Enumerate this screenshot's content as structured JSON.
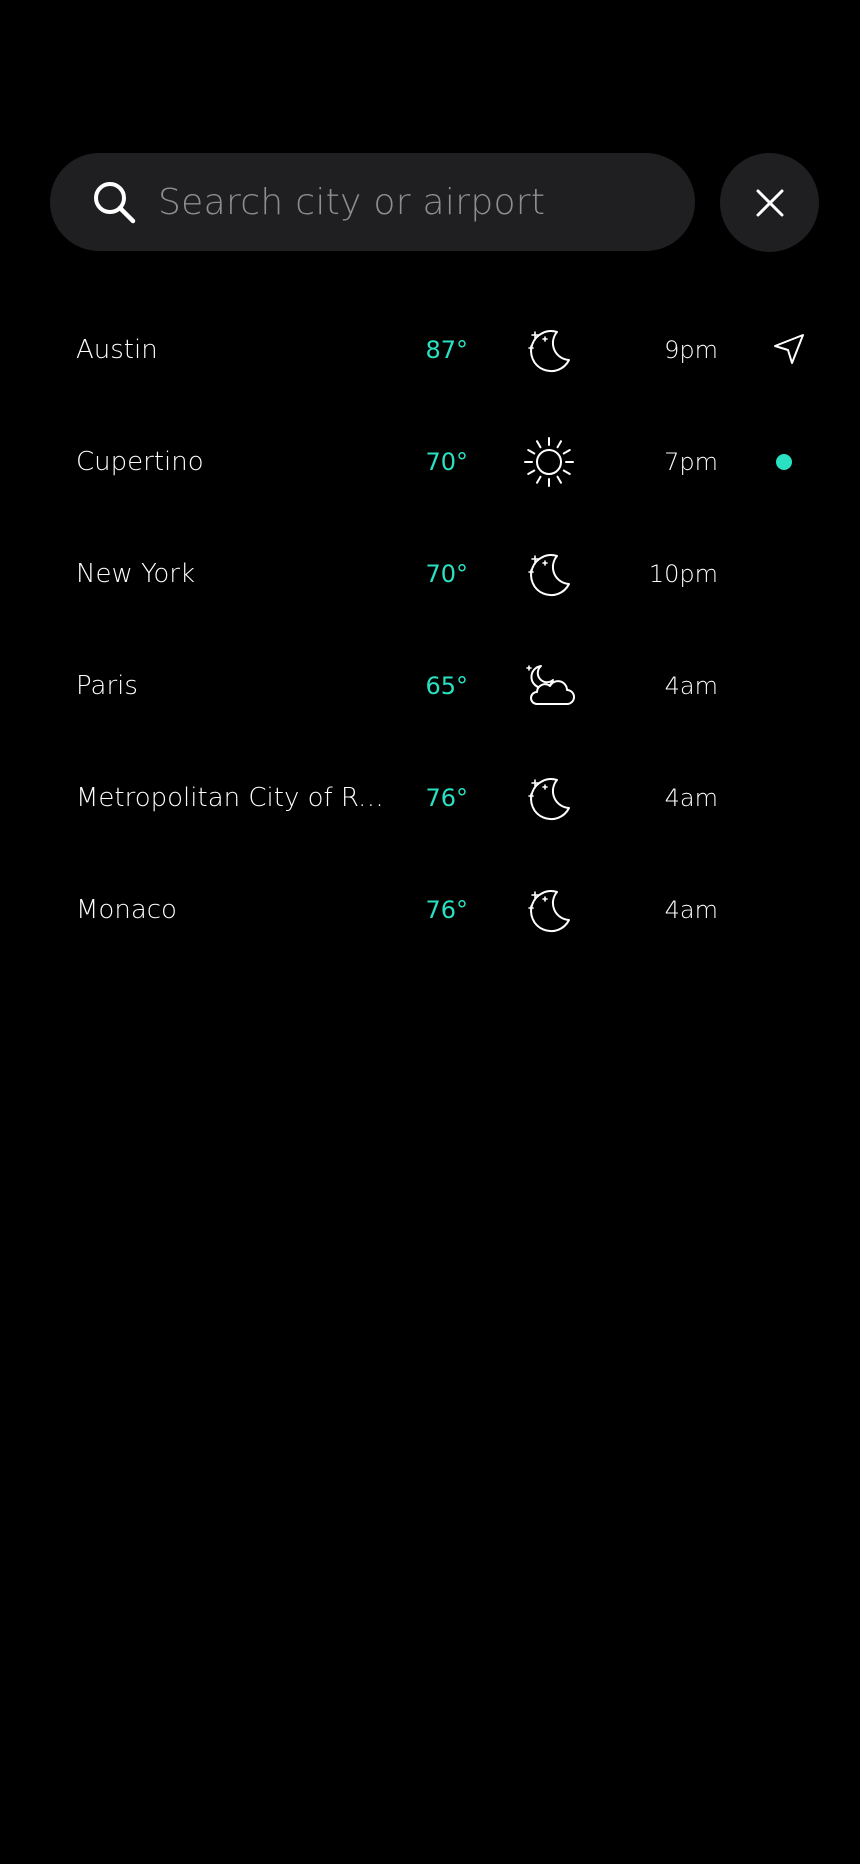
{
  "search": {
    "placeholder": "Search city or airport",
    "value": ""
  },
  "icons": {
    "search": "search-icon",
    "close": "close-icon",
    "location": "location-arrow-icon",
    "night_clear": "moon-stars-icon",
    "sunny": "sun-icon",
    "night_partly_cloudy": "moon-cloud-icon"
  },
  "colors": {
    "background": "#000000",
    "surface": "#1f1f21",
    "accent": "#29e0c0",
    "placeholder": "#8e8e92",
    "text": "#ffffff"
  },
  "locations": [
    {
      "city": "Austin",
      "temp": "87°",
      "condition": "moon-stars-icon",
      "time": "9pm",
      "marker": "location-arrow-icon"
    },
    {
      "city": "Cupertino",
      "temp": "70°",
      "condition": "sun-icon",
      "time": "7pm",
      "marker": "current-dot"
    },
    {
      "city": "New York",
      "temp": "70°",
      "condition": "moon-stars-icon",
      "time": "10pm",
      "marker": ""
    },
    {
      "city": "Paris",
      "temp": "65°",
      "condition": "moon-cloud-icon",
      "time": "4am",
      "marker": ""
    },
    {
      "city": "Metropolitan City of Ro...",
      "temp": "76°",
      "condition": "moon-stars-icon",
      "time": "4am",
      "marker": ""
    },
    {
      "city": "Monaco",
      "temp": "76°",
      "condition": "moon-stars-icon",
      "time": "4am",
      "marker": ""
    }
  ]
}
